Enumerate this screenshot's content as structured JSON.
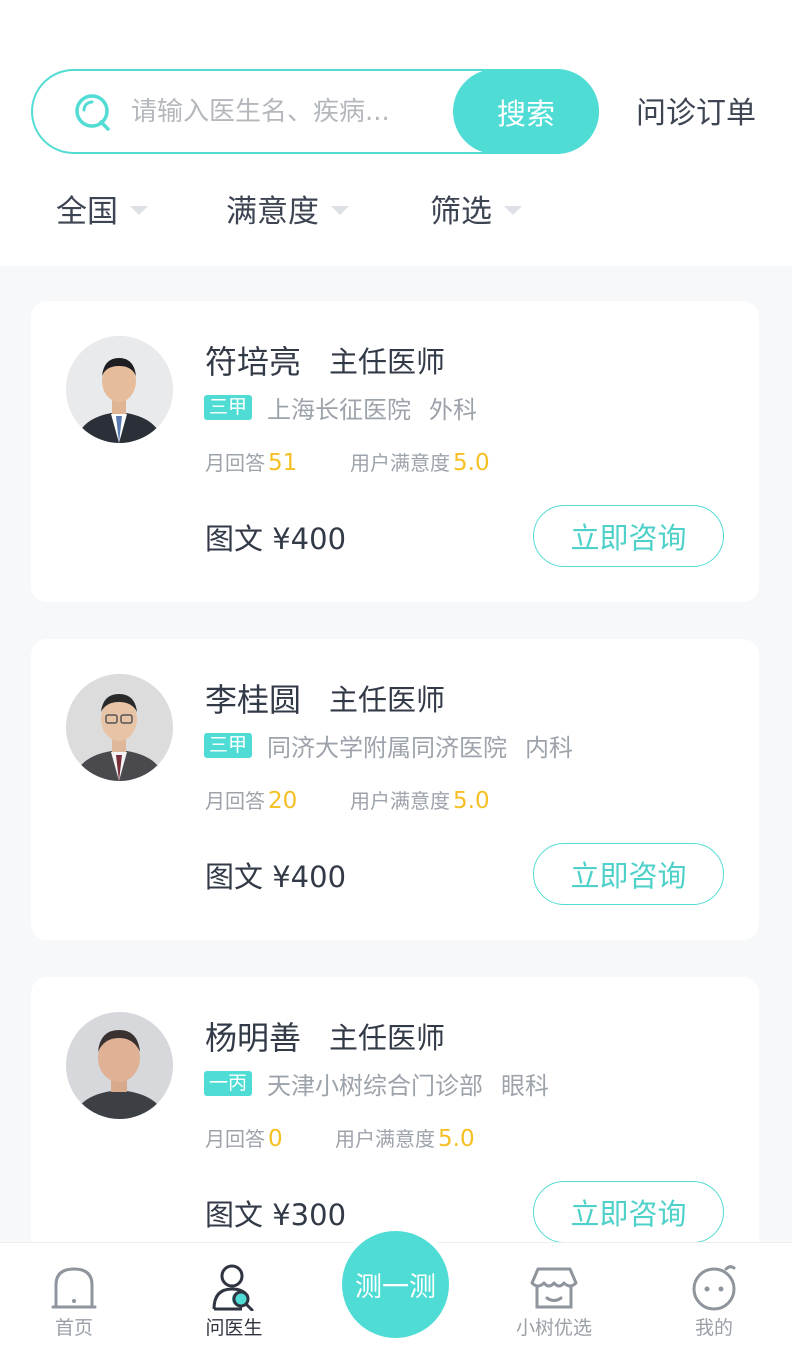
{
  "search": {
    "placeholder": "请输入医生名、疾病...",
    "button_label": "搜索"
  },
  "header": {
    "orders_label": "问诊订单"
  },
  "filters": [
    {
      "label": "全国"
    },
    {
      "label": "满意度"
    },
    {
      "label": "筛选"
    }
  ],
  "doctors": [
    {
      "name": "符培亮",
      "title": "主任医师",
      "grade": "三甲",
      "hospital": "上海长征医院",
      "department": "外科",
      "monthly_label": "月回答",
      "monthly_value": "51",
      "satisfaction_label": "用户满意度",
      "satisfaction_value": "5.0",
      "price_label": "图文 ¥400",
      "consult_label": "立即咨询"
    },
    {
      "name": "李桂圆",
      "title": "主任医师",
      "grade": "三甲",
      "hospital": "同济大学附属同济医院",
      "department": "内科",
      "monthly_label": "月回答",
      "monthly_value": "20",
      "satisfaction_label": "用户满意度",
      "satisfaction_value": "5.0",
      "price_label": "图文 ¥400",
      "consult_label": "立即咨询"
    },
    {
      "name": "杨明善",
      "title": "主任医师",
      "grade": "一丙",
      "hospital": "天津小树综合门诊部",
      "department": "眼科",
      "monthly_label": "月回答",
      "monthly_value": "0",
      "satisfaction_label": "用户满意度",
      "satisfaction_value": "5.0",
      "price_label": "图文 ¥300",
      "consult_label": "立即咨询"
    }
  ],
  "tabbar": {
    "home": "首页",
    "ask_doctor": "问医生",
    "center": "测一测",
    "shop": "小树优选",
    "mine": "我的"
  },
  "colors": {
    "accent": "#4fdcd5",
    "highlight_number": "#f5c024",
    "text_primary": "#333a47",
    "text_secondary": "#9da3ab"
  }
}
